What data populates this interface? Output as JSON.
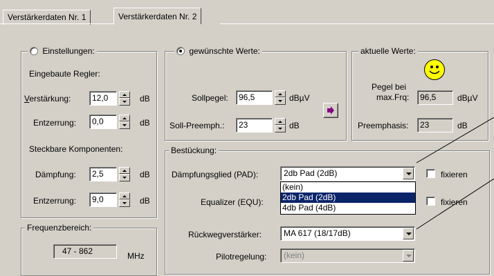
{
  "tabs": [
    {
      "label": "Verstärkerdaten Nr. 1",
      "active": false
    },
    {
      "label": "Verstärkerdaten Nr. 2",
      "active": true
    }
  ],
  "einstellungen": {
    "legend": "Einstellungen:",
    "selected": false,
    "eingebaute_title": "Eingebaute Regler:",
    "verstaerkung": {
      "label_underlined": "V",
      "label_rest": "erstärkung:",
      "value": "12,0",
      "unit": "dB"
    },
    "entzerrung1": {
      "label": "Entzerrung:",
      "value": "0,0",
      "unit": "dB"
    },
    "steckbare_title": "Steckbare Komponenten:",
    "daempfung": {
      "label": "Dämpfung:",
      "value": "2,5",
      "unit": "dB"
    },
    "entzerrung2": {
      "label": "Entzerrung:",
      "value": "9,0",
      "unit": "dB"
    }
  },
  "frequenz": {
    "legend": "Frequenzbereich:",
    "value": "47 - 862",
    "unit": "MHz"
  },
  "gewuenscht": {
    "legend": "gewünschte Werte:",
    "selected": true,
    "sollpegel": {
      "label": "Sollpegel:",
      "value": "96,5",
      "unit": "dBµV"
    },
    "preemph": {
      "label": "Soll-Preemph.:",
      "value": "23",
      "unit": "dB"
    },
    "apply_icon": "arrow-right-icon"
  },
  "aktuell": {
    "legend": "aktuelle Werte:",
    "status_icon": "smiley-icon",
    "pegel_label_line1": "Pegel bei",
    "pegel_label_line2": "max.Frq:",
    "pegel_value": "96,5",
    "pegel_unit": "dBµV",
    "preemphasis_label": "Preemphasis:",
    "preemphasis_value": "23",
    "preemphasis_unit": "dB"
  },
  "bestueckung": {
    "legend": "Bestückung:",
    "pad": {
      "label": "Dämpfungsglied (PAD):",
      "value": "2db Pad  (2dB)",
      "fix_label": "fixieren",
      "fixed": false
    },
    "dropdown_options": [
      "(kein)",
      "2db Pad  (2dB)",
      "4db Pad  (4dB)"
    ],
    "dropdown_selected": 1,
    "equ": {
      "label": "Equalizer (EQU):",
      "fix_label": "fixieren",
      "fixed": false
    },
    "rueckweg": {
      "label": "Rückwegverstärker:",
      "value": "MA 617 (18/17dB)"
    },
    "pilot": {
      "label": "Pilotregelung:",
      "value": "(kein)",
      "disabled": true
    }
  },
  "colors": {
    "face": "#d4d0c8",
    "selection": "#0a246a",
    "apply_arrow": "#800080",
    "smiley": "#ffff00"
  }
}
